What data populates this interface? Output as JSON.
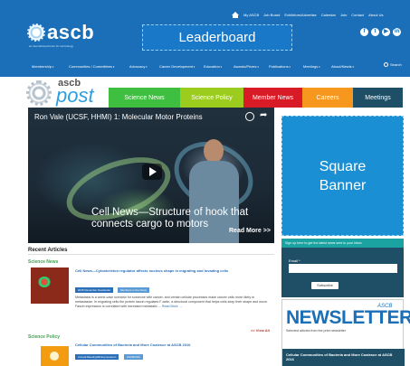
{
  "header": {
    "top_links": [
      "My ASCB",
      "Job Board",
      "Exhibitors/Advertise",
      "Calendar",
      "Join",
      "Contact",
      "About Us"
    ],
    "logo_text": "ascb",
    "logo_subtext": "an international forum for cell biology",
    "leaderboard_label": "Leaderboard",
    "social": [
      {
        "icon": "facebook-icon",
        "glyph": "f"
      },
      {
        "icon": "twitter-icon",
        "glyph": "t"
      },
      {
        "icon": "youtube-icon",
        "glyph": "▶"
      },
      {
        "icon": "linkedin-icon",
        "glyph": "in"
      }
    ],
    "nav": [
      "Membership",
      "Communities / Committees",
      "Advocacy",
      "Career Development",
      "Education",
      "Awards/Prizes",
      "Publications",
      "Meetings",
      "About/Newts"
    ],
    "search_label": "Search"
  },
  "post": {
    "ascb": "ascb",
    "word": "post",
    "tabs": [
      {
        "label": "Science News",
        "color": "#3fbf3f"
      },
      {
        "label": "Science Policy",
        "color": "#9ccc1e"
      },
      {
        "label": "Member News",
        "color": "#d81b27"
      },
      {
        "label": "Careers",
        "color": "#f8971d"
      },
      {
        "label": "Meetings",
        "color": "#1e4f66"
      }
    ]
  },
  "video": {
    "title": "Ron Vale (UCSF, HHMI) 1: Molecular Motor Proteins",
    "caption": "Cell News—Structure of hook that connects cargo to motors",
    "read_more": "Read More >>"
  },
  "square_banner": {
    "line1": "Square",
    "line2": "Banner"
  },
  "recent": {
    "title": "Recent Articles",
    "science_news_label": "Science News",
    "article1": {
      "title": "Cell News—Cytoskeleton regulator affects nucleus shape in migrating and invading cells",
      "tags": [
        {
          "label": "2015 December Newsletter",
          "color": "#2a6fb7"
        },
        {
          "label": "Members in the News",
          "color": "#5b9bd5"
        }
      ],
      "body": "Metastasis is a worst-case scenario for someone with cancer, and certain cellular processes make cancer cells more likely to metastasize. In migrating cells the protein fascin regulates F-actin, a structural component that helps cells keep their shape and move. Fascin expression is correlated with increased metastatic ...",
      "read_more": "Read More →"
    },
    "view_all": "<< View All",
    "science_policy_label": "Science Policy",
    "article2": {
      "title": "Cellular Communities of Bacteria and More Coalesce at ASCB 2016",
      "tags": [
        {
          "label": "Annual Meeting/Minisymposium",
          "color": "#2a6fb7"
        },
        {
          "label": "ASCB2016",
          "color": "#5b9bd5"
        }
      ]
    }
  },
  "signup": {
    "heading": "Sign up here to get the latest news sent to your inbox",
    "email_label": "Email *",
    "email_value": "",
    "button": "Subscribe"
  },
  "newsletter": {
    "ascb": "ASCB",
    "word": "NEWSLETTER",
    "description": "Selected articles from the print newsletter",
    "featured": "Cellular Communities of Bacteria and More Coalesce at ASCB 2016"
  }
}
